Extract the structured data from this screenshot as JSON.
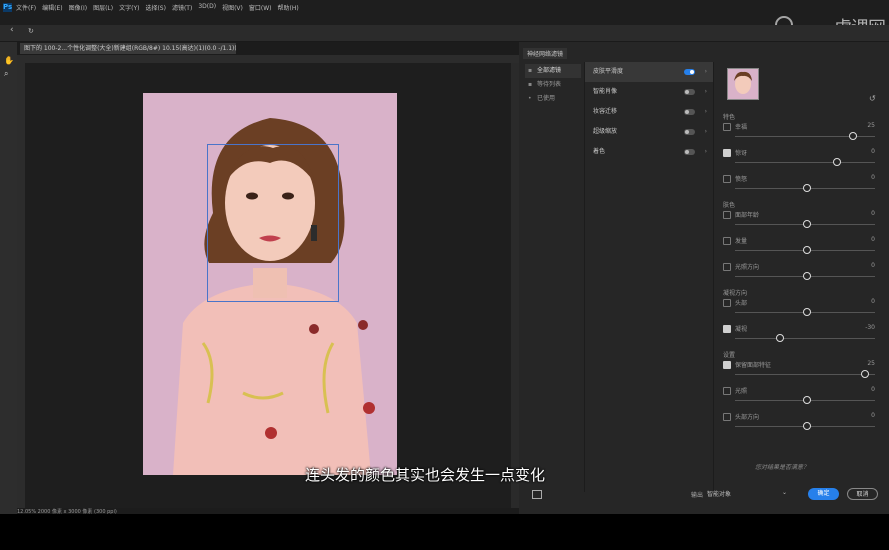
{
  "app": {
    "logo": "Ps"
  },
  "menu": [
    "文件(F)",
    "编辑(E)",
    "图像(I)",
    "图层(L)",
    "文字(Y)",
    "选择(S)",
    "滤镜(T)",
    "3D(D)",
    "视图(V)",
    "窗口(W)",
    "帮助(H)"
  ],
  "watermark": "虎课网",
  "document_tab": "图下的 100-2...个性化调整(大全)新建组(RGB/8#) 10.15(高达)(1)(0.0 -/1.1)(1(0.20.7) *",
  "status_bar": "12.05%     2000 像素 x 3000 像素 (300 ppi)",
  "dialog": {
    "title": "神经网络滤镜",
    "categories": [
      {
        "label": "全部滤镜",
        "selected": true
      },
      {
        "label": "等待列表",
        "selected": false
      },
      {
        "label": "已使用",
        "selected": false
      }
    ],
    "filters": [
      {
        "label": "皮肤平滑度",
        "on": true,
        "selected": true
      },
      {
        "label": "智能肖像",
        "on": false,
        "selected": false
      },
      {
        "label": "妆容迁移",
        "on": false,
        "selected": false
      },
      {
        "label": "超级缩放",
        "on": false,
        "selected": false
      },
      {
        "label": "着色",
        "on": false,
        "selected": false
      }
    ],
    "settings": [
      {
        "section": "特色"
      },
      {
        "label": "幸福",
        "checked": false,
        "value": "25",
        "pos": 0.84
      },
      {
        "label": "惊讶",
        "checked": true,
        "value": "0",
        "pos": 0.72
      },
      {
        "label": "愤怒",
        "checked": false,
        "value": "0",
        "pos": 0.5
      },
      {
        "section": "肤色"
      },
      {
        "label": "面部年龄",
        "checked": false,
        "value": "0",
        "pos": 0.5
      },
      {
        "label": "发量",
        "checked": false,
        "value": "0",
        "pos": 0.5
      },
      {
        "label": "光照方向",
        "checked": false,
        "value": "0",
        "pos": 0.5
      },
      {
        "section": "凝视方向"
      },
      {
        "label": "头部",
        "checked": false,
        "value": "0",
        "pos": 0.5
      },
      {
        "label": "凝视",
        "checked": true,
        "value": "-30",
        "pos": 0.3
      },
      {
        "section": "设置"
      },
      {
        "label": "保留面部特征",
        "checked": true,
        "value": "25",
        "pos": 0.93
      },
      {
        "label": "光照",
        "checked": false,
        "value": "0",
        "pos": 0.5
      },
      {
        "label": "头部方向",
        "checked": false,
        "value": "0",
        "pos": 0.5
      }
    ],
    "footer_hint": "您对结果是否满意？",
    "output_label": "输出",
    "output_value": "智能对象",
    "ok": "确定",
    "cancel": "取消"
  },
  "subtitle": "连头发的颜色其实也会发生一点变化"
}
